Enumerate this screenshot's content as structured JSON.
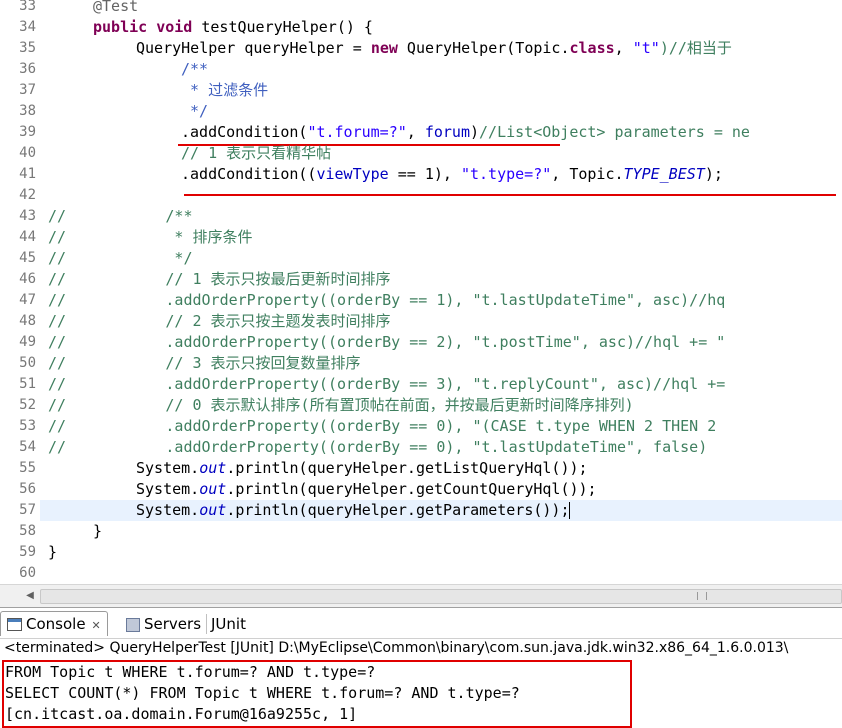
{
  "editor": {
    "line_numbers": [
      "33",
      "34",
      "35",
      "36",
      "37",
      "38",
      "39",
      "40",
      "41",
      "42",
      "43",
      "44",
      "45",
      "46",
      "47",
      "48",
      "49",
      "50",
      "51",
      "52",
      "53",
      "54",
      "55",
      "56",
      "57",
      "58",
      "59",
      "60"
    ],
    "line33": {
      "annotation": "@Test"
    },
    "line34": {
      "kw": "public void",
      "text": " testQueryHelper() {"
    },
    "line35": {
      "a": "QueryHelper queryHelper = ",
      "kw": "new",
      "b": " QueryHelper(Topic.",
      "kw2": "class",
      "c": ", ",
      "str": "\"t\"",
      "d": ")//相当于"
    },
    "line36": {
      "text": "/**"
    },
    "line37": {
      "text": " * 过滤条件"
    },
    "line38": {
      "text": " */"
    },
    "line39": {
      "a": ".addCondition(",
      "str": "\"t.forum=?\"",
      "b": ", ",
      "fld": "forum",
      "c": ")",
      "com": "//List<Object> parameters = ne"
    },
    "line40": {
      "text": "// 1 表示只看精华帖"
    },
    "line41": {
      "a": ".addCondition((",
      "fld": "viewType",
      "b": " == 1), ",
      "str": "\"t.type=?\"",
      "c": ", Topic.",
      "stf": "TYPE_BEST",
      "d": ");"
    },
    "line43": {
      "text": "//           /**"
    },
    "line44": {
      "text": "//            * 排序条件"
    },
    "line45": {
      "text": "//            */"
    },
    "line46": {
      "text": "//           // 1 表示只按最后更新时间排序"
    },
    "line47": {
      "text": "//           .addOrderProperty((orderBy == 1), \"t.lastUpdateTime\", asc)//hq"
    },
    "line48": {
      "text": "//           // 2 表示只按主题发表时间排序"
    },
    "line49": {
      "text": "//           .addOrderProperty((orderBy == 2), \"t.postTime\", asc)//hql += \""
    },
    "line50": {
      "text": "//           // 3 表示只按回复数量排序"
    },
    "line51": {
      "text": "//           .addOrderProperty((orderBy == 3), \"t.replyCount\", asc)//hql +="
    },
    "line52": {
      "text": "//           // 0 表示默认排序(所有置顶帖在前面，并按最后更新时间降序排列)"
    },
    "line53": {
      "text": "//           .addOrderProperty((orderBy == 0), \"(CASE t.type WHEN 2 THEN 2"
    },
    "line54": {
      "text": "//           .addOrderProperty((orderBy == 0), \"t.lastUpdateTime\", false)"
    },
    "line55": {
      "a": "System.",
      "mi": "out",
      "b": ".println(queryHelper.getListQueryHql());"
    },
    "line56": {
      "a": "System.",
      "mi": "out",
      "b": ".println(queryHelper.getCountQueryHql());"
    },
    "line57": {
      "a": "System.",
      "mi": "out",
      "b": ".println(queryHelper.getParameters());"
    },
    "line58": {
      "text": "}"
    },
    "line59": {
      "text": "}"
    }
  },
  "tabs": {
    "console": "Console",
    "console_close": "✕",
    "servers": "Servers",
    "junit": "JUnit"
  },
  "status": "<terminated> QueryHelperTest [JUnit] D:\\MyEclipse\\Common\\binary\\com.sun.java.jdk.win32.x86_64_1.6.0.013\\",
  "console": {
    "lines": [
      "FROM Topic t WHERE t.forum=? AND t.type=?",
      "SELECT COUNT(*) FROM Topic t WHERE t.forum=? AND t.type=?",
      "[cn.itcast.oa.domain.Forum@16a9255c, 1]"
    ]
  },
  "colors": {
    "keyword": "#7f0055",
    "string": "#2a00ff",
    "comment": "#3f7f5f",
    "javadoc": "#3f5fbf",
    "field": "#0000c0",
    "highlight": "#e00000"
  }
}
